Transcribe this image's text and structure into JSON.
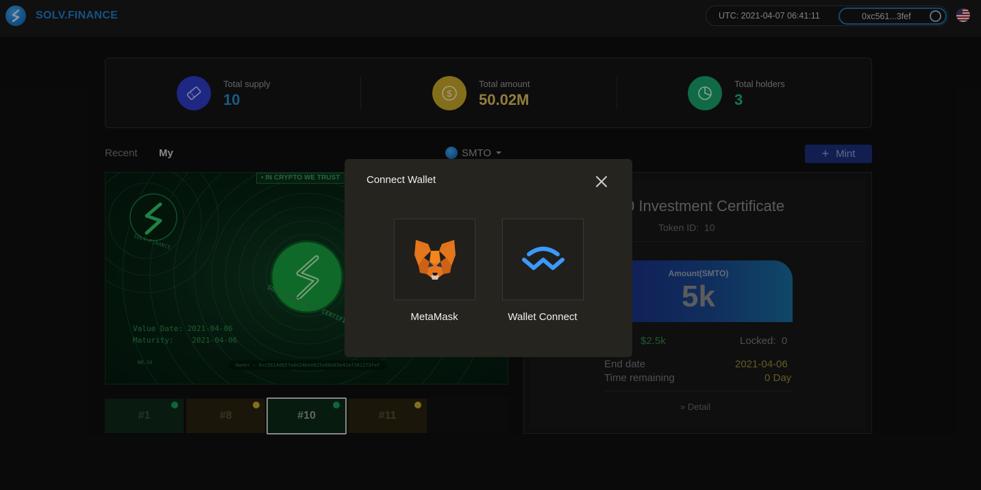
{
  "header": {
    "brand": "SOLV.FINANCE",
    "utc": "UTC: 2021-04-07 06:41:11",
    "address": "0xc561...3fef",
    "logo_icon": "solv-logo-icon",
    "flag_icon": "us-flag-icon"
  },
  "stats": [
    {
      "label": "Total supply",
      "value": "10",
      "icon": "ticket-icon",
      "color": "#2f3cc7",
      "value_color": "#2a8ad0"
    },
    {
      "label": "Total amount",
      "value": "50.02M",
      "icon": "coin-icon",
      "color": "#c9a92a",
      "value_color": "#e0c060"
    },
    {
      "label": "Total holders",
      "value": "3",
      "icon": "pie-chart-icon",
      "color": "#1aa36a",
      "value_color": "#1db97a"
    }
  ],
  "tabs": {
    "recent": "Recent",
    "my": "My"
  },
  "token_select": {
    "value": "SMTO"
  },
  "mint_button": {
    "label": "Mint"
  },
  "certificate": {
    "banner": "• IN CRYPTO WE TRUST",
    "brand": "SOLV.FINANCE",
    "arc_text": "SOLV INVESTMENT CERTIFICATE",
    "value_date": "Value Date: 2021-04-06",
    "maturity": "Maturity:    2021-04-06",
    "number": "NO.10",
    "owner": "Owner : 0xc5614db57a4e24bee825e08a03e41af281273fef"
  },
  "thumbnails": [
    {
      "label": "#1",
      "color": "#1a9a5a"
    },
    {
      "label": "#8",
      "color": "#c9a92a"
    },
    {
      "label": "#10",
      "color": "#1a9a5a",
      "selected": true
    },
    {
      "label": "#11",
      "color": "#c9a92a"
    }
  ],
  "detail": {
    "title": "0 Investment Certificate",
    "token_id": "Token ID:  10",
    "amount_label": "Amount(SMTO)",
    "amount_value": "5k",
    "usd": "$2.5k",
    "locked": "Locked:  0",
    "end_date_label": "End date",
    "end_date_value": "2021-04-06",
    "time_remaining_label": "Time remaining",
    "time_remaining_value": "0 Day",
    "detail_link": "» Detail"
  },
  "modal": {
    "title": "Connect Wallet",
    "wallets": [
      {
        "name": "MetaMask",
        "icon": "metamask-fox-icon"
      },
      {
        "name": "Wallet Connect",
        "icon": "walletconnect-icon"
      }
    ]
  }
}
